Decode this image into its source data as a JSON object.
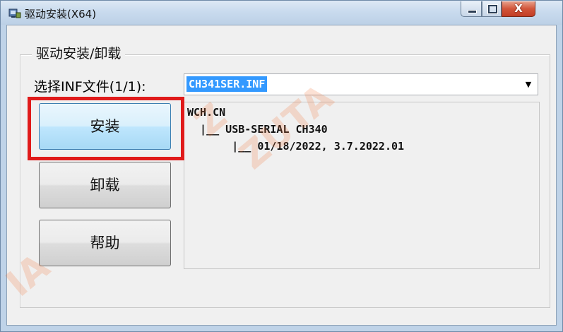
{
  "window": {
    "title": "驱动安装(X64)",
    "close_glyph": "X"
  },
  "group": {
    "label": "驱动安装/卸载"
  },
  "inf_selector": {
    "label": "选择INF文件(1/1):",
    "selected_value": "CH341SER.INF",
    "arrow_glyph": "▼"
  },
  "buttons": {
    "install": "安装",
    "uninstall": "卸载",
    "help": "帮助"
  },
  "driver_tree": {
    "lines": [
      "WCH.CN",
      "  |__ USB-SERIAL CH340",
      "       |__ 01/18/2022, 3.7.2022.01"
    ]
  },
  "watermark": {
    "text_1": "Z",
    "text_2": "ZUTA",
    "text_3": "IA"
  },
  "colors": {
    "highlight_box": "#e01a1a",
    "selection": "#3399ff",
    "close_button": "#c23d25"
  }
}
